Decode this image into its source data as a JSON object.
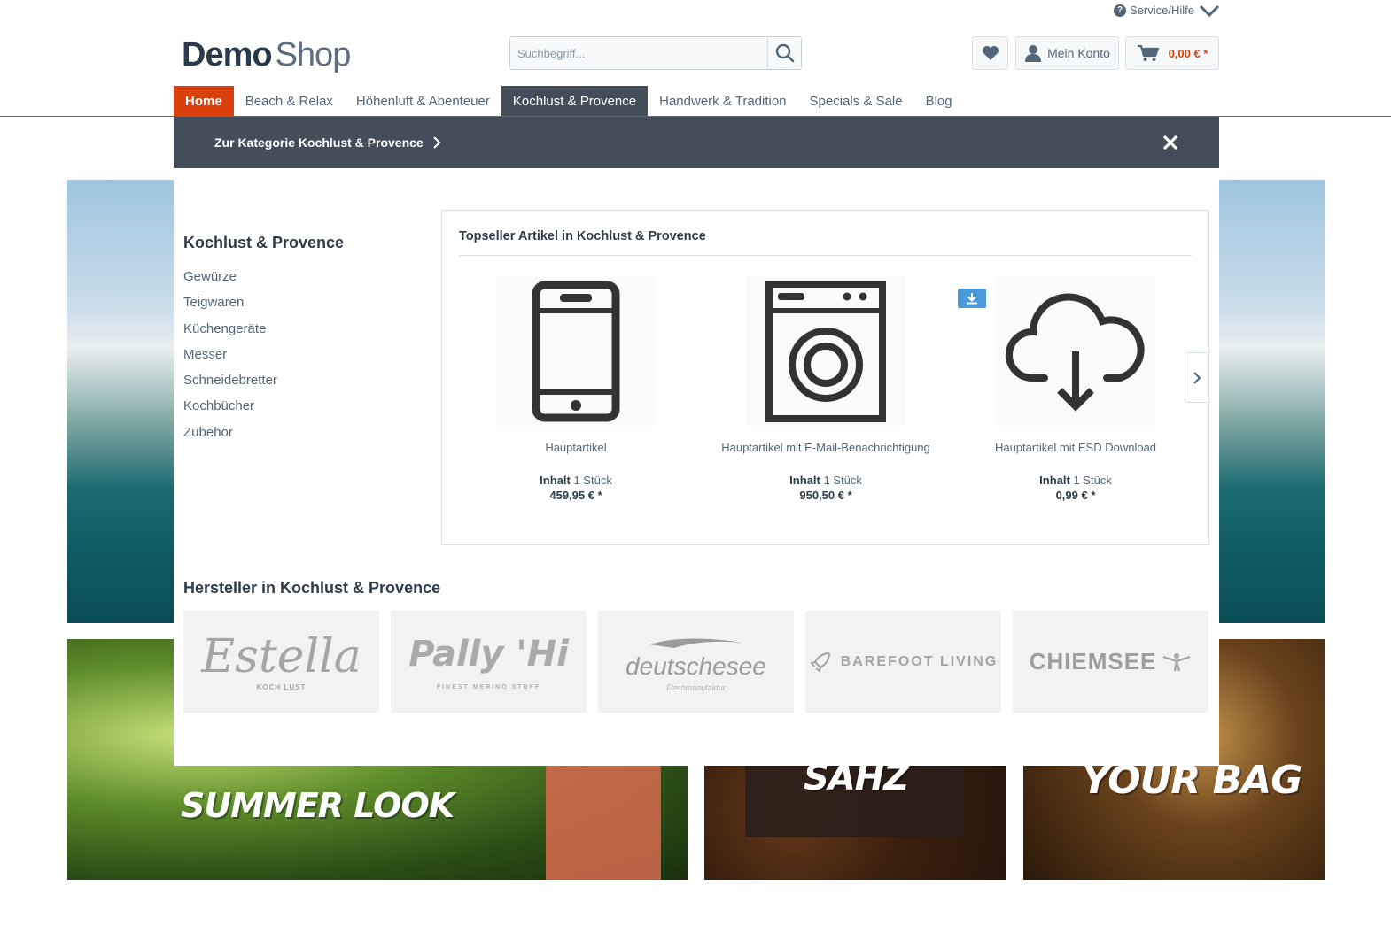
{
  "service": {
    "label": "Service/Hilfe"
  },
  "logo": {
    "part1": "Demo",
    "part2": "Shop"
  },
  "search": {
    "placeholder": "Suchbegriff..."
  },
  "account": {
    "label": "Mein Konto"
  },
  "cart": {
    "amount": "0,00 € *"
  },
  "nav": {
    "items": [
      {
        "label": "Home"
      },
      {
        "label": "Beach & Relax"
      },
      {
        "label": "Höhenluft & Abenteuer"
      },
      {
        "label": "Kochlust & Provence"
      },
      {
        "label": "Handwerk & Tradition"
      },
      {
        "label": "Specials & Sale"
      },
      {
        "label": "Blog"
      }
    ]
  },
  "mega": {
    "to_category": "Zur Kategorie Kochlust & Provence",
    "category_title": "Kochlust & Provence",
    "subcategories": [
      "Gewürze",
      "Teigwaren",
      "Küchengeräte",
      "Messer",
      "Schneidebretter",
      "Kochbücher",
      "Zubehör"
    ],
    "topseller_title": "Topseller Artikel in Kochlust & Provence",
    "products": [
      {
        "name": "Hauptartikel",
        "content_label": "Inhalt",
        "content_value": "1 Stück",
        "price": "459,95 € *",
        "icon": "smartphone-icon"
      },
      {
        "name": "Hauptartikel mit E-Mail-Benachrichtigung",
        "content_label": "Inhalt",
        "content_value": "1 Stück",
        "price": "950,50 € *",
        "icon": "washing-machine-icon"
      },
      {
        "name": "Hauptartikel mit ESD Download",
        "content_label": "Inhalt",
        "content_value": "1 Stück",
        "price": "0,99 € *",
        "icon": "cloud-download-icon"
      }
    ],
    "manufacturer_title": "Hersteller in Kochlust & Provence",
    "manufacturers": [
      {
        "name": "Estella",
        "tagline": "KOCH LUST"
      },
      {
        "name": "Pally 'Hi",
        "tagline": "FINEST MERINO STUFF"
      },
      {
        "name": "deutschesee",
        "tagline": "Fischmanufaktur"
      },
      {
        "name": "BAREFOOT LIVING",
        "tagline": ""
      },
      {
        "name": "CHIEMSEE",
        "tagline": ""
      }
    ]
  },
  "banners": {
    "summer": "SUMMER LOOK",
    "kitchen": "SAHZ",
    "bag": "YOUR BAG"
  },
  "colors": {
    "accent": "#d9400b",
    "dark": "#434e5a",
    "text": "#52667a",
    "esd_badge": "#4a9ad9"
  }
}
